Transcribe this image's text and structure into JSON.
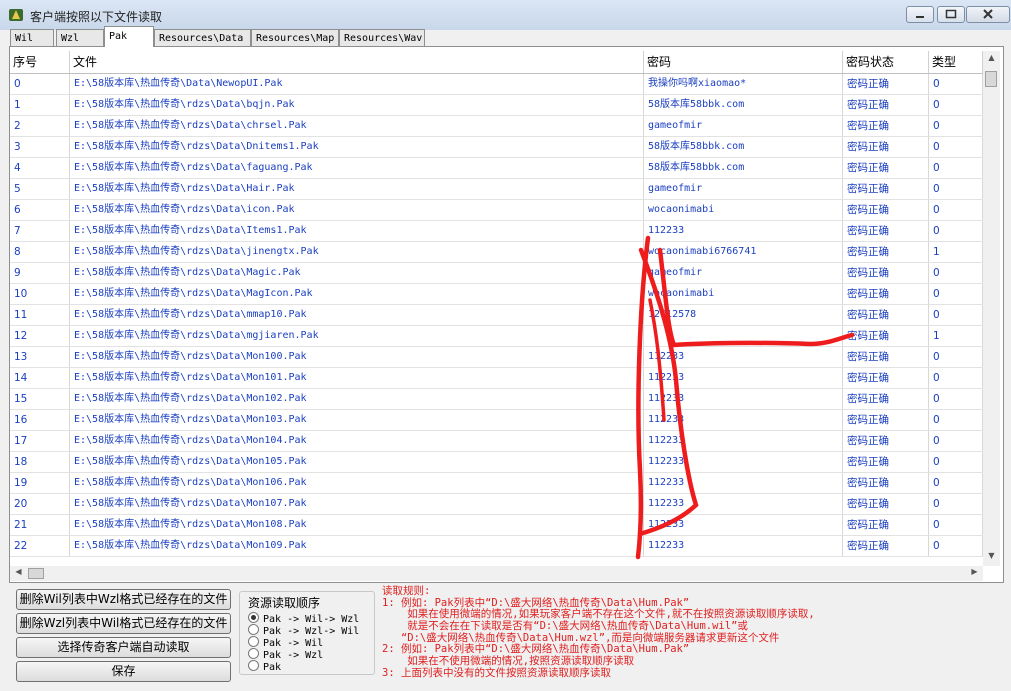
{
  "window": {
    "title": "客户端按照以下文件读取"
  },
  "tabs": [
    "Wil",
    "Wzl",
    "Pak",
    "Resources\\Data",
    "Resources\\Map",
    "Resources\\Wav"
  ],
  "table": {
    "headers": [
      "序号",
      "文件",
      "密码",
      "密码状态",
      "类型"
    ],
    "rows": [
      [
        "0",
        "E:\\58版本库\\热血传奇\\Data\\NewopUI.Pak",
        "我操你吗啊xiaomao*",
        "密码正确",
        "0"
      ],
      [
        "1",
        "E:\\58版本库\\热血传奇\\rdzs\\Data\\bqjn.Pak",
        "58版本库58bbk.com",
        "密码正确",
        "0"
      ],
      [
        "2",
        "E:\\58版本库\\热血传奇\\rdzs\\Data\\chrsel.Pak",
        "gameofmir",
        "密码正确",
        "0"
      ],
      [
        "3",
        "E:\\58版本库\\热血传奇\\rdzs\\Data\\Dnitems1.Pak",
        "58版本库58bbk.com",
        "密码正确",
        "0"
      ],
      [
        "4",
        "E:\\58版本库\\热血传奇\\rdzs\\Data\\faguang.Pak",
        "58版本库58bbk.com",
        "密码正确",
        "0"
      ],
      [
        "5",
        "E:\\58版本库\\热血传奇\\rdzs\\Data\\Hair.Pak",
        "gameofmir",
        "密码正确",
        "0"
      ],
      [
        "6",
        "E:\\58版本库\\热血传奇\\rdzs\\Data\\icon.Pak",
        "wocaonimabi",
        "密码正确",
        "0"
      ],
      [
        "7",
        "E:\\58版本库\\热血传奇\\rdzs\\Data\\Items1.Pak",
        "112233",
        "密码正确",
        "0"
      ],
      [
        "8",
        "E:\\58版本库\\热血传奇\\rdzs\\Data\\jinengtx.Pak",
        "wocaonimabi6766741",
        "密码正确",
        "1"
      ],
      [
        "9",
        "E:\\58版本库\\热血传奇\\rdzs\\Data\\Magic.Pak",
        "gameofmir",
        "密码正确",
        "0"
      ],
      [
        "10",
        "E:\\58版本库\\热血传奇\\rdzs\\Data\\MagIcon.Pak",
        "wocaonimabi",
        "密码正确",
        "0"
      ],
      [
        "11",
        "E:\\58版本库\\热血传奇\\rdzs\\Data\\mmap10.Pak",
        "12412578",
        "密码正确",
        "0"
      ],
      [
        "12",
        "E:\\58版本库\\热血传奇\\rdzs\\Data\\mgjiaren.Pak",
        "",
        "密码正确",
        "1"
      ],
      [
        "13",
        "E:\\58版本库\\热血传奇\\rdzs\\Data\\Mon100.Pak",
        "112233",
        "密码正确",
        "0"
      ],
      [
        "14",
        "E:\\58版本库\\热血传奇\\rdzs\\Data\\Mon101.Pak",
        "112233",
        "密码正确",
        "0"
      ],
      [
        "15",
        "E:\\58版本库\\热血传奇\\rdzs\\Data\\Mon102.Pak",
        "112233",
        "密码正确",
        "0"
      ],
      [
        "16",
        "E:\\58版本库\\热血传奇\\rdzs\\Data\\Mon103.Pak",
        "112233",
        "密码正确",
        "0"
      ],
      [
        "17",
        "E:\\58版本库\\热血传奇\\rdzs\\Data\\Mon104.Pak",
        "112233",
        "密码正确",
        "0"
      ],
      [
        "18",
        "E:\\58版本库\\热血传奇\\rdzs\\Data\\Mon105.Pak",
        "112233",
        "密码正确",
        "0"
      ],
      [
        "19",
        "E:\\58版本库\\热血传奇\\rdzs\\Data\\Mon106.Pak",
        "112233",
        "密码正确",
        "0"
      ],
      [
        "20",
        "E:\\58版本库\\热血传奇\\rdzs\\Data\\Mon107.Pak",
        "112233",
        "密码正确",
        "0"
      ],
      [
        "21",
        "E:\\58版本库\\热血传奇\\rdzs\\Data\\Mon108.Pak",
        "112233",
        "密码正确",
        "0"
      ],
      [
        "22",
        "E:\\58版本库\\热血传奇\\rdzs\\Data\\Mon109.Pak",
        "112233",
        "密码正确",
        "0"
      ]
    ]
  },
  "buttons": {
    "delete_wil": "删除Wil列表中Wzl格式已经存在的文件",
    "delete_wzl": "删除Wzl列表中Wil格式已经存在的文件",
    "auto_read": "选择传奇客户端自动读取",
    "save": "保存"
  },
  "order_group": {
    "title": "资源读取顺序",
    "options": [
      "Pak -> Wil-> Wzl",
      "Pak -> Wzl-> Wil",
      "Pak -> Wil",
      "Pak -> Wzl",
      "Pak"
    ]
  },
  "rules": [
    "读取规则:",
    "1: 例如: Pak列表中“D:\\盛大网络\\热血传奇\\Data\\Hum.Pak”",
    "    如果在使用微端的情况,如果玩家客户端不存在这个文件,就不在按照资源读取顺序读取,",
    "    就是不会在在下读取是否有“D:\\盛大网络\\热血传奇\\Data\\Hum.wil”或",
    "   “D:\\盛大网络\\热血传奇\\Data\\Hum.wzl”,而是向微端服务器请求更新这个文件",
    "2: 例如: Pak列表中“D:\\盛大网络\\热血传奇\\Data\\Hum.Pak”",
    "    如果在不使用微端的情况,按照资源读取顺序读取",
    "3: 上面列表中没有的文件按照资源读取顺序读取"
  ],
  "colors": {
    "cell_text": "#1a3fc0",
    "rules_text": "#e02020",
    "annotation": "#ee1c1c"
  },
  "icons": {
    "app": "app-icon",
    "minimize": "minimize-icon",
    "maximize": "maximize-icon",
    "close": "close-icon"
  }
}
